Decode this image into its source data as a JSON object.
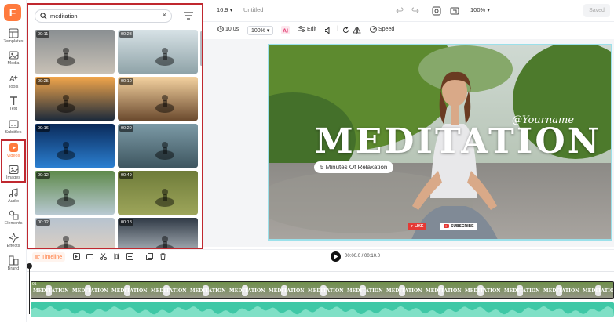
{
  "app": {
    "logo_letter": "F"
  },
  "rail": [
    {
      "id": "templates",
      "label": "Templates",
      "icon": "templates-icon"
    },
    {
      "id": "media",
      "label": "Media",
      "icon": "media-icon"
    },
    {
      "id": "tools",
      "label": "Tools",
      "icon": "tools-icon"
    },
    {
      "id": "text",
      "label": "Text",
      "icon": "text-icon"
    },
    {
      "id": "subtitles",
      "label": "Subtitles",
      "icon": "subtitles-icon"
    },
    {
      "id": "videos",
      "label": "Videos",
      "icon": "videos-icon",
      "active": true
    },
    {
      "id": "images",
      "label": "Images",
      "icon": "images-icon"
    },
    {
      "id": "audio",
      "label": "Audio",
      "icon": "audio-icon"
    },
    {
      "id": "elements",
      "label": "Elements",
      "icon": "elements-icon"
    },
    {
      "id": "effects",
      "label": "Effects",
      "icon": "effects-icon"
    },
    {
      "id": "brand",
      "label": "Brand",
      "icon": "brand-icon"
    }
  ],
  "search": {
    "value": "meditation",
    "clear_glyph": "×"
  },
  "thumbnails": [
    {
      "duration": "00:11"
    },
    {
      "duration": "00:23"
    },
    {
      "duration": "00:25"
    },
    {
      "duration": "00:10"
    },
    {
      "duration": "00:16"
    },
    {
      "duration": "00:20"
    },
    {
      "duration": "00:12"
    },
    {
      "duration": "00:49"
    },
    {
      "duration": "00:12"
    },
    {
      "duration": "00:18"
    }
  ],
  "toolbar": {
    "aspect": "16:9 ▾",
    "title": "Untitled",
    "zoom": "100% ▾",
    "saved": "Saved"
  },
  "subtoolbar": {
    "duration": "10.0s",
    "scale": "100% ▾",
    "edit": "Edit",
    "speed": "Speed"
  },
  "canvas": {
    "title": "MEDITATION",
    "signature": "@Yourname",
    "subtitle": "5 Minutes Of Relaxation",
    "like": "LIKE",
    "subscribe": "SUBSCRIBE"
  },
  "timeline": {
    "label": "Timeline",
    "time": "00:00.0 / 00:10.0",
    "track_index": "01",
    "clip_label": "MEDITATION"
  }
}
